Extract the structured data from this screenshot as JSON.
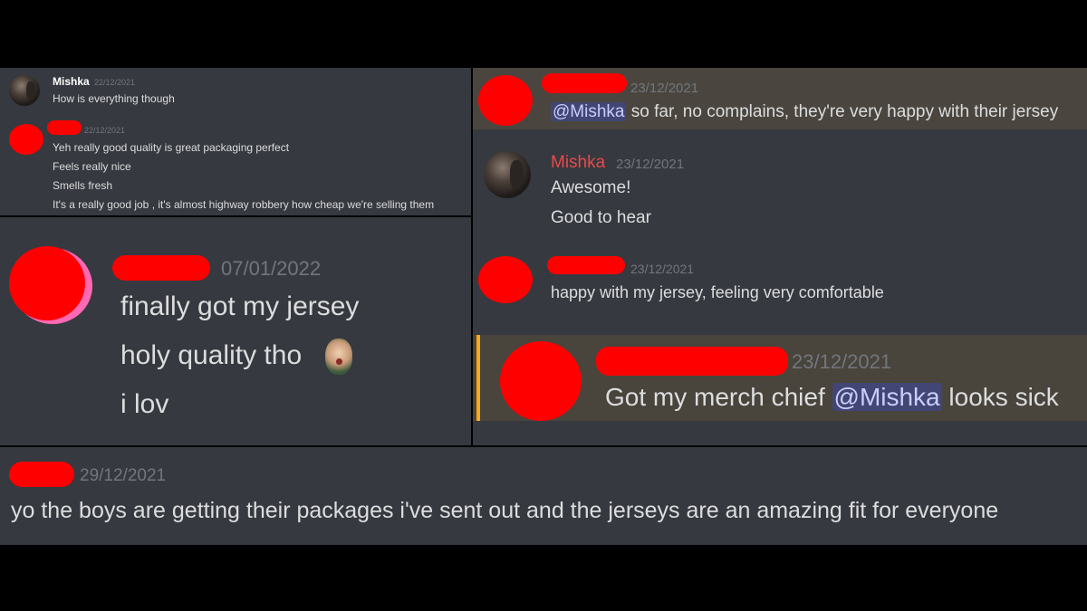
{
  "top_left": {
    "msg1": {
      "author": "Mishka",
      "timestamp": "22/12/2021",
      "lines": [
        "How is everything though"
      ]
    },
    "msg2": {
      "timestamp": "22/12/2021",
      "lines": [
        "Yeh really good quality is great packaging perfect",
        "Feels really nice",
        "Smells fresh",
        "It's a really good job , it's almost highway robbery how cheap we're selling them"
      ]
    }
  },
  "mid_left": {
    "timestamp": "07/01/2022",
    "lines": [
      "finally got my jersey",
      "holy quality tho",
      "i lov"
    ]
  },
  "right": {
    "msg1": {
      "timestamp": "23/12/2021",
      "mention": "@Mishka",
      "text": " so far, no complains, they're very happy with their jersey"
    },
    "msg2": {
      "author": "Mishka",
      "author_color": "#f04747",
      "timestamp": "23/12/2021",
      "lines": [
        "Awesome!",
        "Good to hear"
      ]
    },
    "msg3": {
      "timestamp": "23/12/2021",
      "lines": [
        "happy with my jersey, feeling very comfortable"
      ]
    },
    "msg4": {
      "timestamp": "23/12/2021",
      "text_before": "Got my merch chief ",
      "mention": "@Mishka",
      "text_after": " looks sick"
    }
  },
  "bottom": {
    "timestamp": "29/12/2021",
    "text": "yo the boys are getting their packages i've sent out and the jerseys are an amazing fit for everyone"
  },
  "colors": {
    "background": "#36393f",
    "text": "#dcddde",
    "timestamp": "#72767d",
    "redaction": "#ff0000",
    "mention_bg": "#414675",
    "highlight_bar": "#faa81a"
  }
}
